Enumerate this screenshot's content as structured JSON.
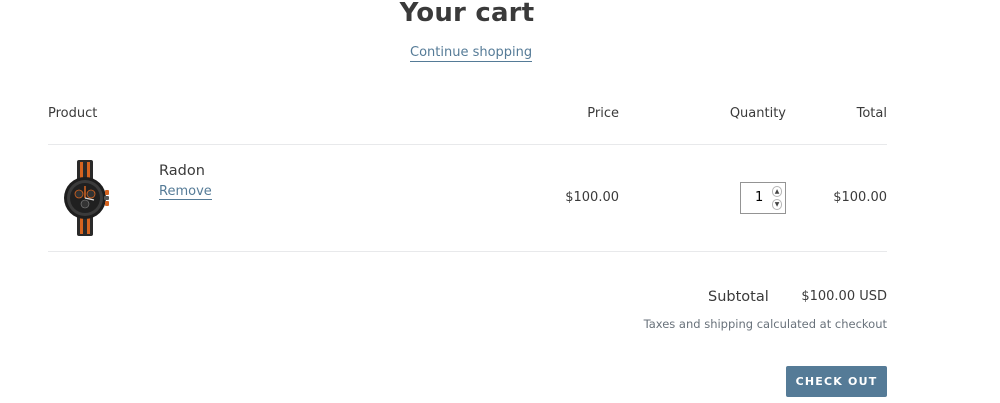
{
  "page": {
    "title": "Your cart",
    "continue_label": "Continue shopping"
  },
  "table": {
    "headers": {
      "product": "Product",
      "price": "Price",
      "quantity": "Quantity",
      "total": "Total"
    },
    "rows": [
      {
        "image_icon": "watch-image",
        "name": "Radon",
        "remove_label": "Remove",
        "price": "$100.00",
        "quantity": "1",
        "total": "$100.00"
      }
    ]
  },
  "summary": {
    "subtotal_label": "Subtotal",
    "subtotal_value": "$100.00 USD",
    "tax_note": "Taxes and shipping calculated at checkout",
    "checkout_label": "Check out"
  },
  "colors": {
    "accent": "#557b97",
    "text": "#3a3a3a",
    "muted": "#69727b",
    "divider": "#e8e9eb"
  }
}
